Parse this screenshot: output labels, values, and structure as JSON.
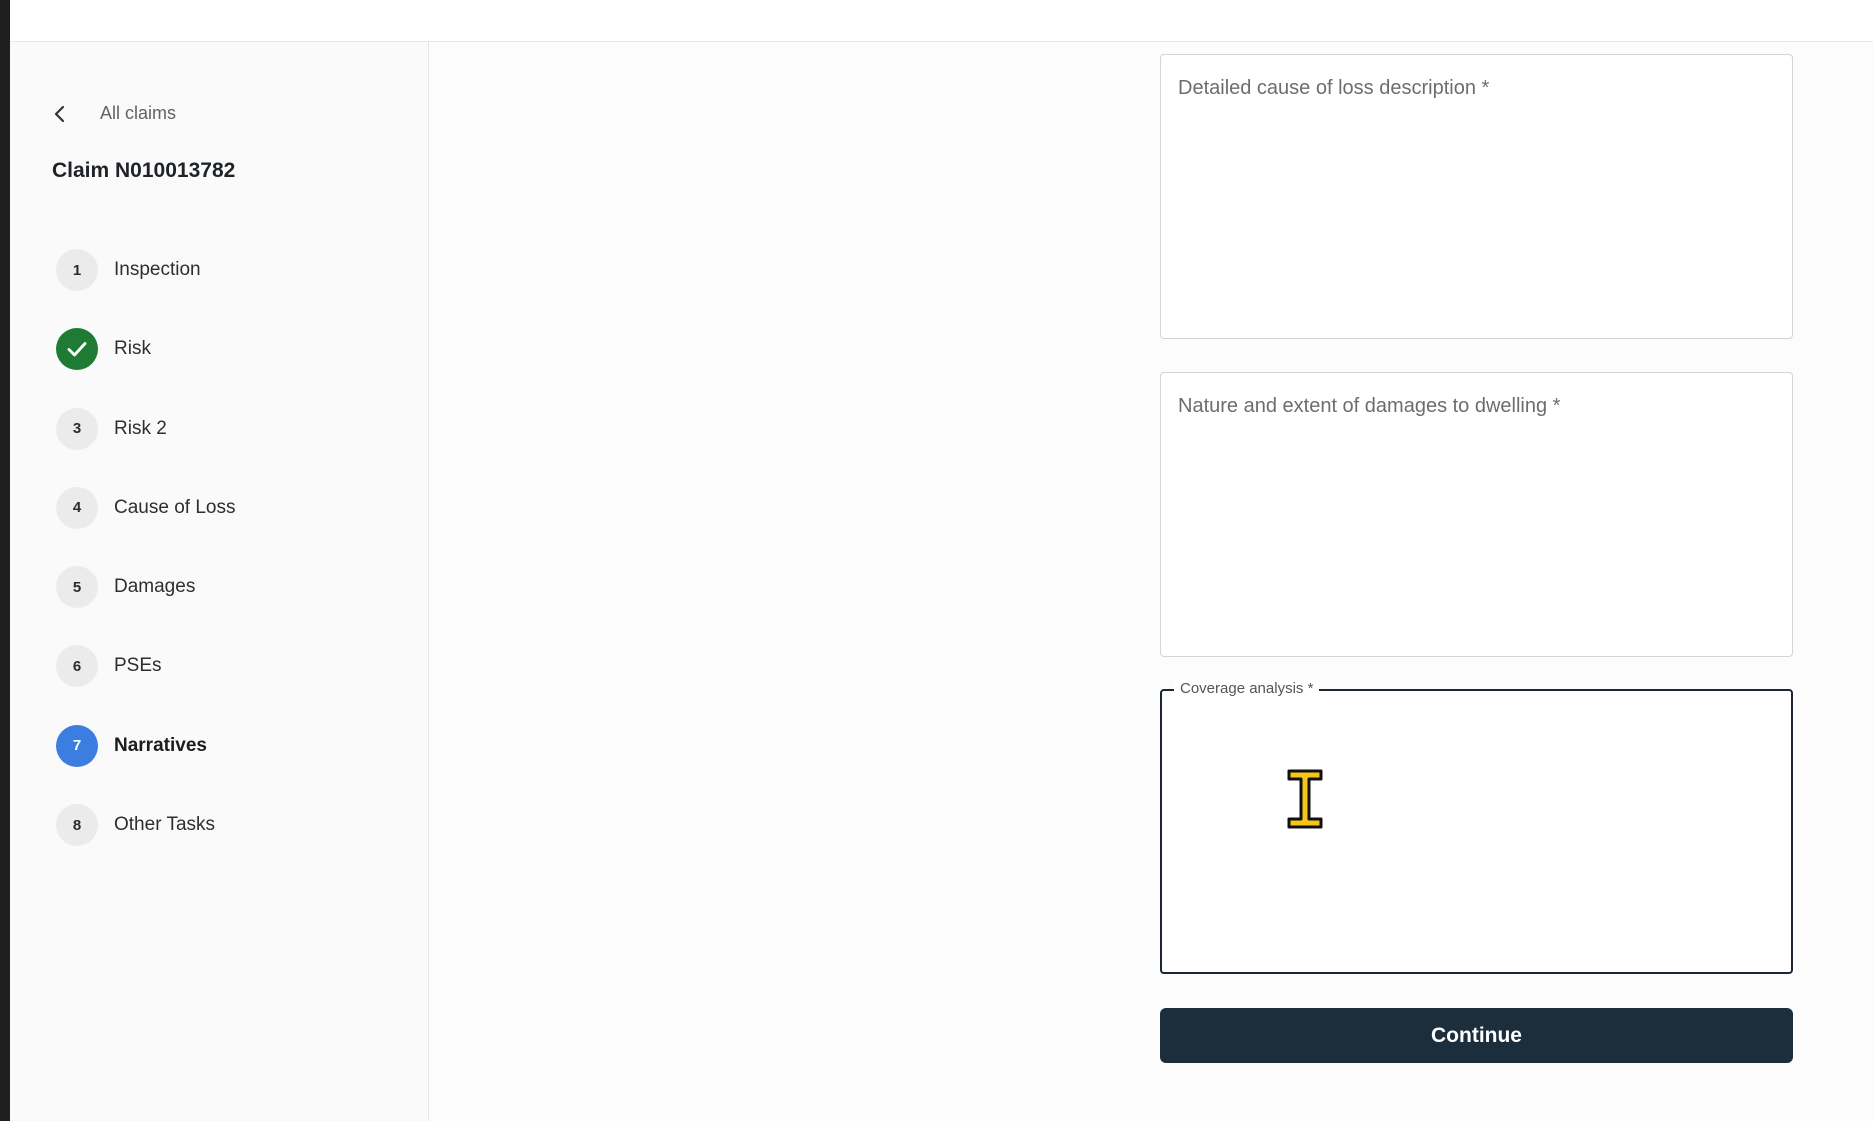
{
  "sidebar": {
    "back_label": "All claims",
    "claim_title": "Claim N010013782",
    "steps": [
      {
        "number": "1",
        "label": "Inspection",
        "state": "pending"
      },
      {
        "number": "",
        "label": "Risk",
        "state": "done"
      },
      {
        "number": "3",
        "label": "Risk 2",
        "state": "pending"
      },
      {
        "number": "4",
        "label": "Cause of Loss",
        "state": "pending"
      },
      {
        "number": "5",
        "label": "Damages",
        "state": "pending"
      },
      {
        "number": "6",
        "label": "PSEs",
        "state": "pending"
      },
      {
        "number": "7",
        "label": "Narratives",
        "state": "active"
      },
      {
        "number": "8",
        "label": "Other Tasks",
        "state": "pending"
      }
    ]
  },
  "form": {
    "cause_of_loss": {
      "placeholder": "Detailed cause of loss description *",
      "value": ""
    },
    "damages_dwelling": {
      "placeholder": "Nature and extent of damages to dwelling *",
      "value": ""
    },
    "coverage_analysis": {
      "label": "Coverage analysis *",
      "value": ""
    },
    "continue_label": "Continue"
  },
  "colors": {
    "done_green": "#1e7b34",
    "active_blue": "#3b7de0",
    "button_dark": "#1c2d3c",
    "cursor_yellow": "#f5c518"
  },
  "icons": {
    "back": "chevron-left-icon",
    "done": "check-icon",
    "cursor": "text-cursor-icon"
  }
}
